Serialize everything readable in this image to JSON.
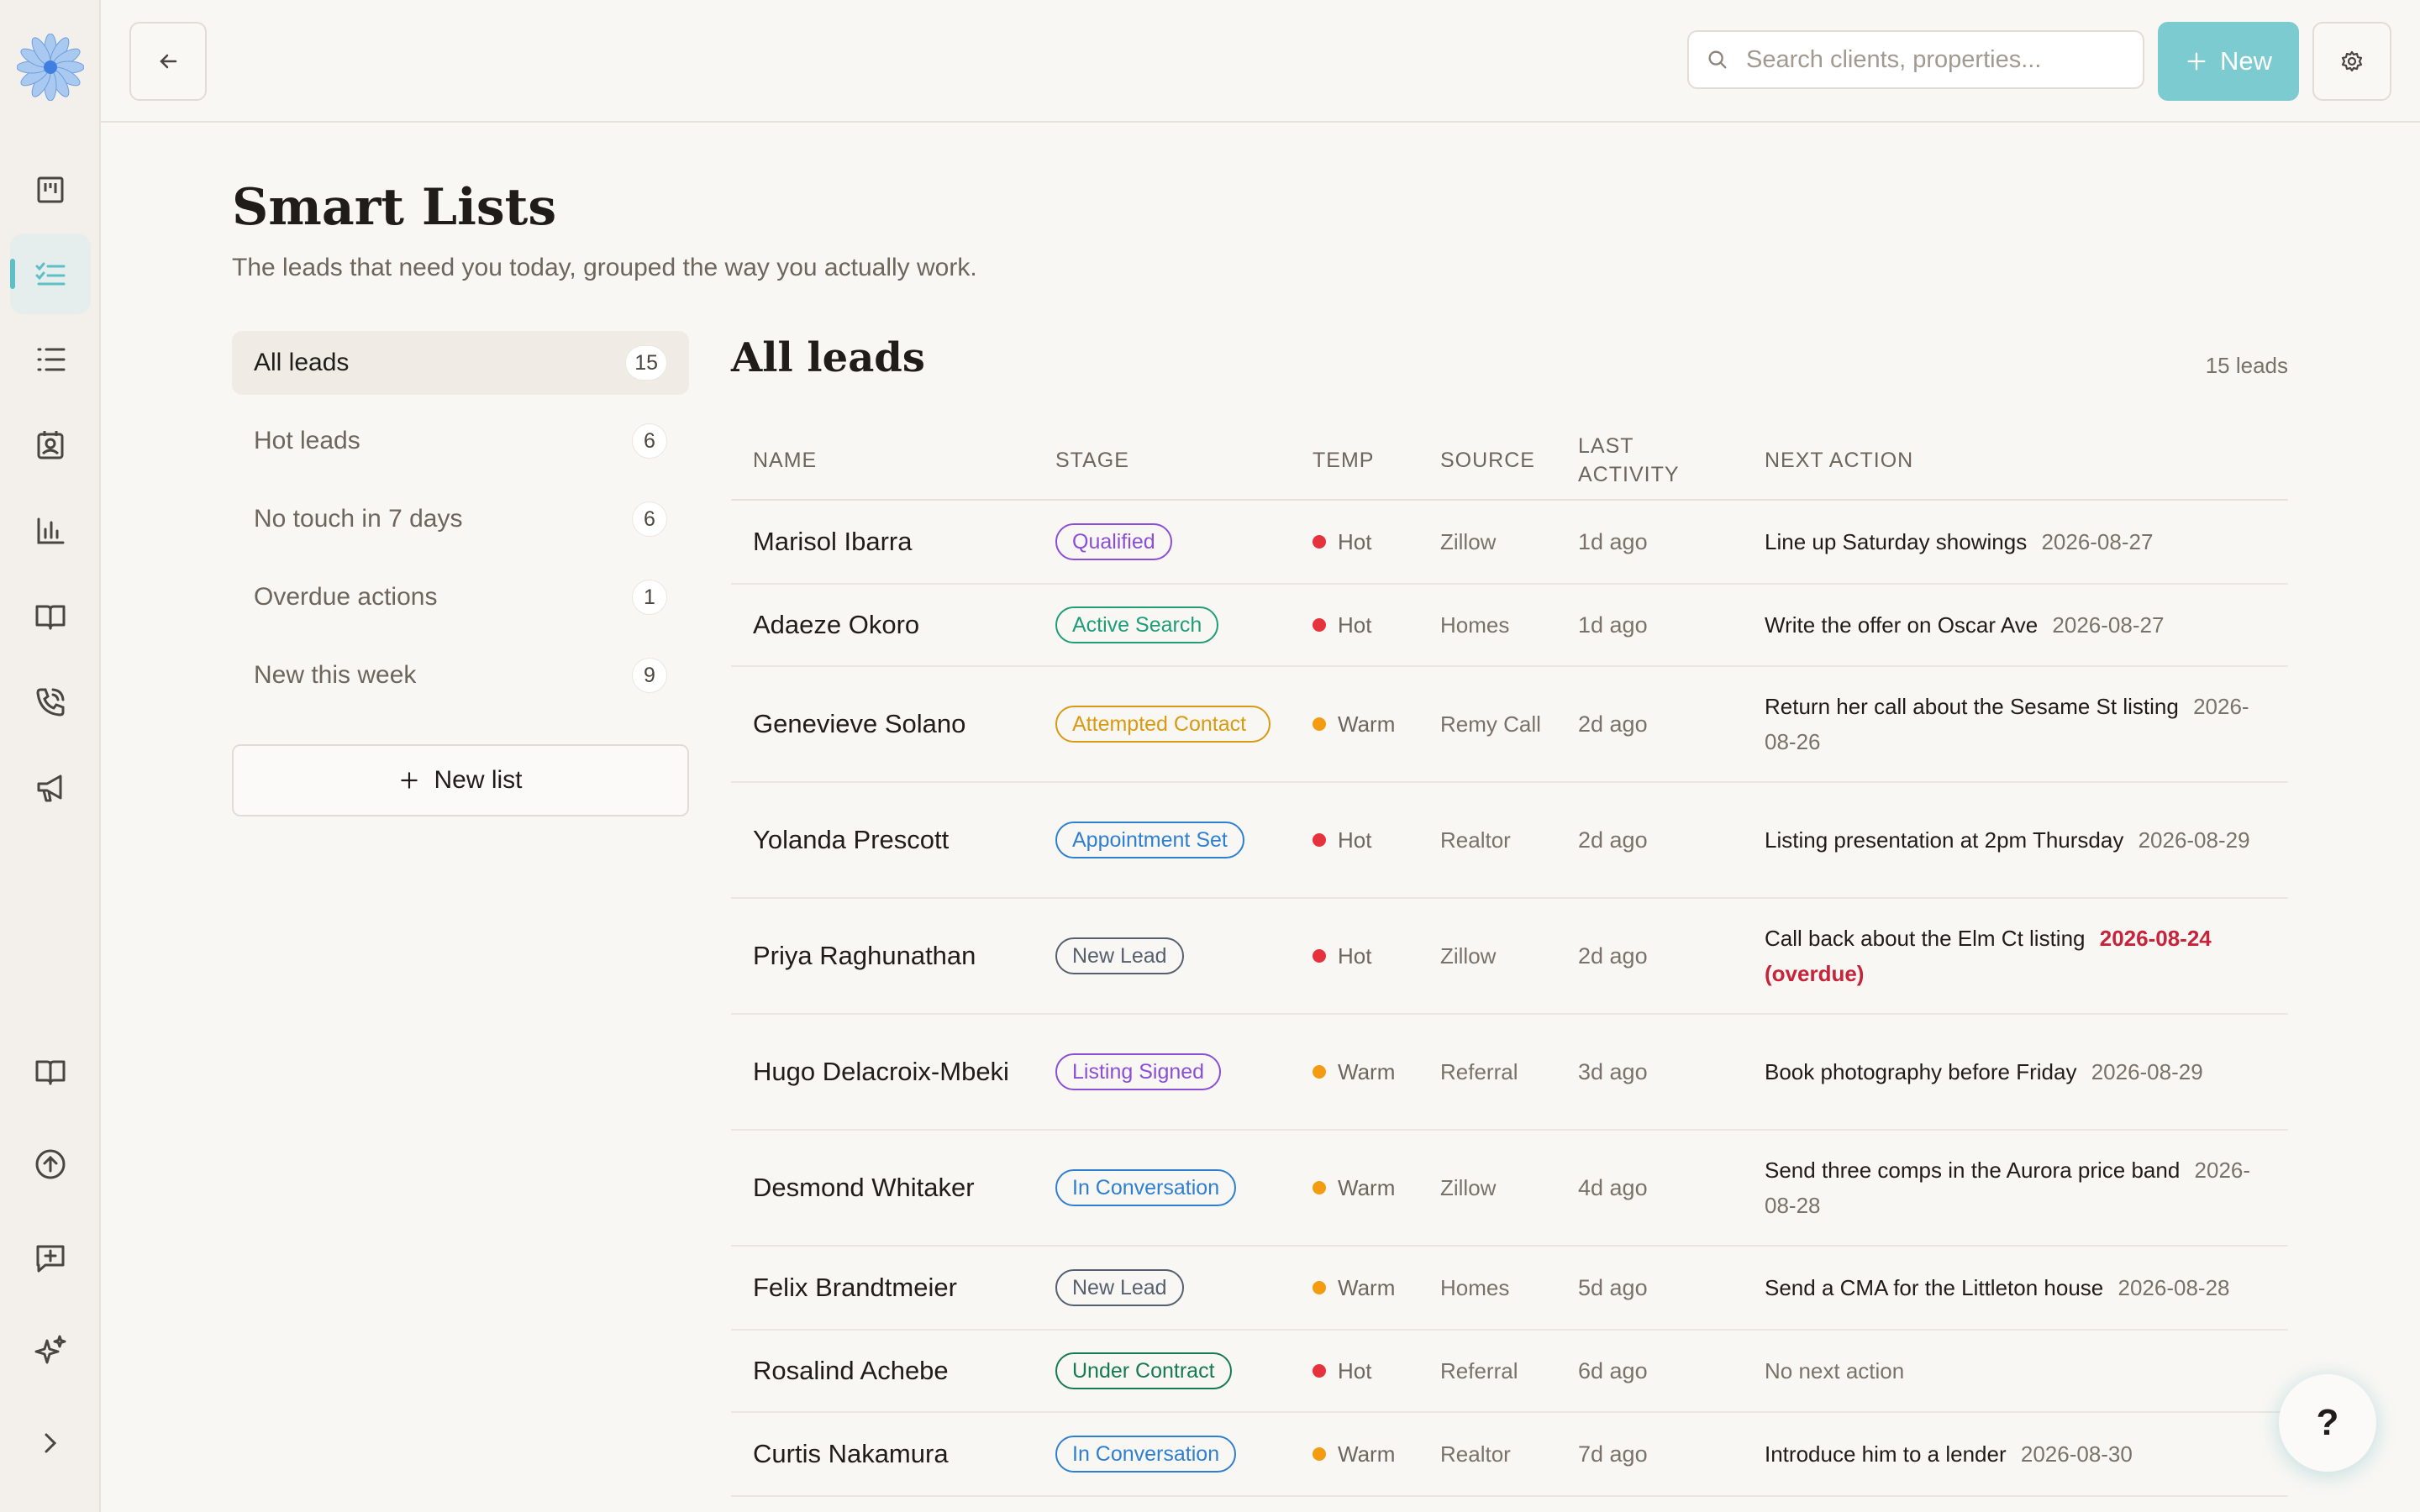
{
  "header": {
    "search_placeholder": "Search clients, properties...",
    "new_label": "New"
  },
  "page": {
    "title": "Smart Lists",
    "subtitle": "The leads that need you today, grouped the way you actually work."
  },
  "lists": [
    {
      "label": "All leads",
      "count": "15"
    },
    {
      "label": "Hot leads",
      "count": "6"
    },
    {
      "label": "No touch in 7 days",
      "count": "6"
    },
    {
      "label": "Overdue actions",
      "count": "1"
    },
    {
      "label": "New this week",
      "count": "9"
    }
  ],
  "new_list_label": "New list",
  "main": {
    "title": "All leads",
    "count_label": "15 leads",
    "columns": [
      "NAME",
      "STAGE",
      "TEMP",
      "SOURCE",
      "LAST ACTIVITY",
      "NEXT ACTION"
    ]
  },
  "colors": {
    "accent": "#7ccbd1",
    "hot": "#e5323d",
    "warm": "#f39c12",
    "overdue": "#c7233a"
  },
  "stage_colors": {
    "Qualified": "#8a4fd6",
    "Active Search": "#1e9d7a",
    "Attempted Contact": "#d99a12",
    "Appointment Set": "#2f7fd1",
    "New Lead": "#55606e",
    "Listing Signed": "#8a4fd6",
    "In Conversation": "#2f7fd1",
    "Under Contract": "#167a52"
  },
  "leads": [
    {
      "name": "Marisol Ibarra",
      "stage": "Qualified",
      "temp": "Hot",
      "source": "Zillow",
      "activity": "1d ago",
      "next": "Line up Saturday showings",
      "due": "2026-08-27"
    },
    {
      "name": "Adaeze Okoro",
      "stage": "Active Search",
      "temp": "Hot",
      "source": "Homes",
      "activity": "1d ago",
      "next": "Write the offer on Oscar Ave",
      "due": "2026-08-27"
    },
    {
      "name": "Genevieve Solano",
      "stage": "Attempted Contact",
      "temp": "Warm",
      "source": "Remy Call",
      "activity": "2d ago",
      "next": "Return her call about the Sesame St listing",
      "due": "2026-08-26"
    },
    {
      "name": "Yolanda Prescott",
      "stage": "Appointment Set",
      "temp": "Hot",
      "source": "Realtor",
      "activity": "2d ago",
      "next": "Listing presentation at 2pm Thursday",
      "due": "2026-08-29"
    },
    {
      "name": "Priya Raghunathan",
      "stage": "New Lead",
      "temp": "Hot",
      "source": "Zillow",
      "activity": "2d ago",
      "next": "Call back about the Elm Ct listing",
      "due": "2026-08-24 (overdue)",
      "overdue": true
    },
    {
      "name": "Hugo Delacroix-Mbeki",
      "stage": "Listing Signed",
      "temp": "Warm",
      "source": "Referral",
      "activity": "3d ago",
      "next": "Book photography before Friday",
      "due": "2026-08-29"
    },
    {
      "name": "Desmond Whitaker",
      "stage": "In Conversation",
      "temp": "Warm",
      "source": "Zillow",
      "activity": "4d ago",
      "next": "Send three comps in the Aurora price band",
      "due": "2026-08-28"
    },
    {
      "name": "Felix Brandtmeier",
      "stage": "New Lead",
      "temp": "Warm",
      "source": "Homes",
      "activity": "5d ago",
      "next": "Send a CMA for the Littleton house",
      "due": "2026-08-28"
    },
    {
      "name": "Rosalind Achebe",
      "stage": "Under Contract",
      "temp": "Hot",
      "source": "Referral",
      "activity": "6d ago",
      "next": "No next action",
      "due": "",
      "no_action": true
    },
    {
      "name": "Curtis Nakamura",
      "stage": "In Conversation",
      "temp": "Warm",
      "source": "Realtor",
      "activity": "7d ago",
      "next": "Introduce him to a lender",
      "due": "2026-08-30"
    }
  ],
  "help_label": "?"
}
